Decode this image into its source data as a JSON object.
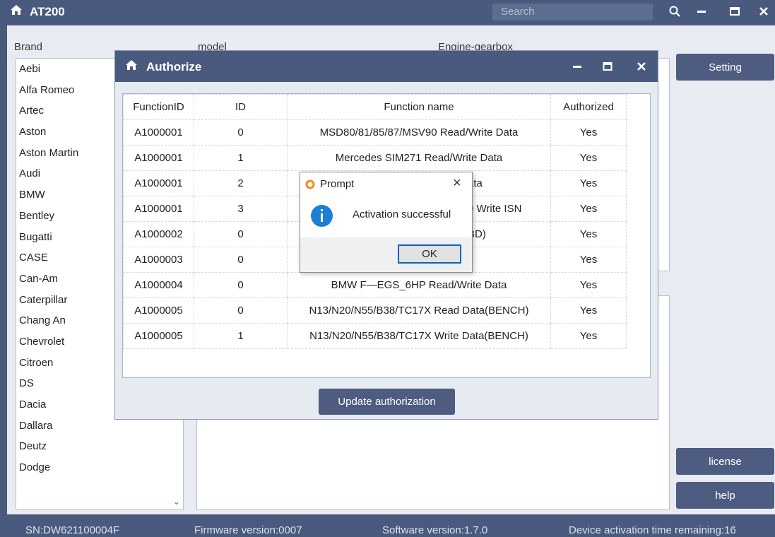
{
  "app": {
    "title": "AT200",
    "search_placeholder": "Search"
  },
  "headers": {
    "brand": "Brand",
    "model": "model",
    "engine": "Engine-gearbox"
  },
  "brands": [
    "Aebi",
    "Alfa Romeo",
    "Artec",
    "Aston",
    "Aston Martin",
    "Audi",
    "BMW",
    "Bentley",
    "Bugatti",
    "CASE",
    "Can-Am",
    "Caterpillar",
    "Chang An",
    "Chevrolet",
    "Citroen",
    "DS",
    "Dacia",
    "Dallara",
    "Deutz",
    "Dodge"
  ],
  "side_buttons": {
    "setting": "Setting",
    "license": "license",
    "help": "help"
  },
  "status": {
    "sn": "SN:DW621100004F",
    "firmware": "Firmware version:0007",
    "software": "Software version:1.7.0",
    "activation": "Device activation time remaining:16"
  },
  "authorize": {
    "title": "Authorize",
    "columns": [
      "FunctionID",
      "ID",
      "Function name",
      "Authorized"
    ],
    "rows": [
      [
        "A1000001",
        "0",
        "MSD80/81/85/87/MSV90 Read/Write Data",
        "Yes"
      ],
      [
        "A1000001",
        "1",
        "Mercedes SIM271 Read/Write Data",
        "Yes"
      ],
      [
        "A1000001",
        "2",
        "ata",
        "Yes"
      ],
      [
        "A1000001",
        "3",
        "0 Write ISN",
        "Yes"
      ],
      [
        "A1000002",
        "0",
        "BD)",
        "Yes"
      ],
      [
        "A1000003",
        "0",
        "",
        "Yes"
      ],
      [
        "A1000004",
        "0",
        "BMW F—EGS_6HP Read/Write Data",
        "Yes"
      ],
      [
        "A1000005",
        "0",
        "N13/N20/N55/B38/TC17X Read Data(BENCH)",
        "Yes"
      ],
      [
        "A1000005",
        "1",
        "N13/N20/N55/B38/TC17X Write Data(BENCH)",
        "Yes"
      ]
    ],
    "update_button": "Update authorization"
  },
  "prompt": {
    "title": "Prompt",
    "message": "Activation successful",
    "ok": "OK",
    "close": "×"
  }
}
